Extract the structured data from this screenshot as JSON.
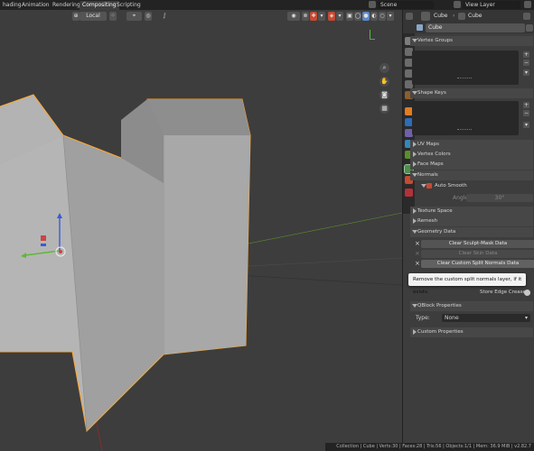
{
  "workspaces": [
    {
      "label": "hading"
    },
    {
      "label": "Animation"
    },
    {
      "label": "Rendering"
    },
    {
      "label": "Compositing",
      "active": true
    },
    {
      "label": "Scripting"
    }
  ],
  "scene": {
    "label": "Scene"
  },
  "view_layer": {
    "label": "View Layer"
  },
  "viewport": {
    "orientation": "Local",
    "gizmo_icons": [
      "zoom-icon",
      "hand-icon",
      "camera-icon",
      "grid-icon"
    ]
  },
  "properties": {
    "object_name": "Cube",
    "mesh_name": "Cube",
    "datablock_name": "Cube",
    "panels": {
      "vertex_groups": "Vertex Groups",
      "shape_keys": "Shape Keys",
      "uv_maps": "UV Maps",
      "vertex_colors": "Vertex Colors",
      "face_maps": "Face Maps",
      "normals": "Normals",
      "auto_smooth": "Auto Smooth",
      "angle_label": "Angle",
      "angle_value": "30°",
      "texture_space": "Texture Space",
      "remesh": "Remesh",
      "geometry_data": "Geometry Data",
      "clear_sculpt": "Clear Sculpt-Mask Data",
      "clear_skin": "Clear Skin Data",
      "clear_custom": "Clear Custom Split Normals Data",
      "store_edge_crease": "Store Edge Crease",
      "qblock": "QBlock Properties",
      "type_label": "Type:",
      "type_value": "None",
      "custom_properties": "Custom Properties"
    }
  },
  "tooltip": "Remove the custom split normals layer, if it exists.",
  "status": "Collection | Cube | Verts:30 | Faces:28 | Tris:56 | Objects:1/1 | Mem: 36.9 MiB | v2.82.7",
  "colors": {
    "viewport_bg": "#3d3d3d",
    "mesh": "#9b9b9b",
    "outline": "#ffa82e",
    "x_axis": "#9a2626",
    "y_axis": "#5a8f2a"
  }
}
